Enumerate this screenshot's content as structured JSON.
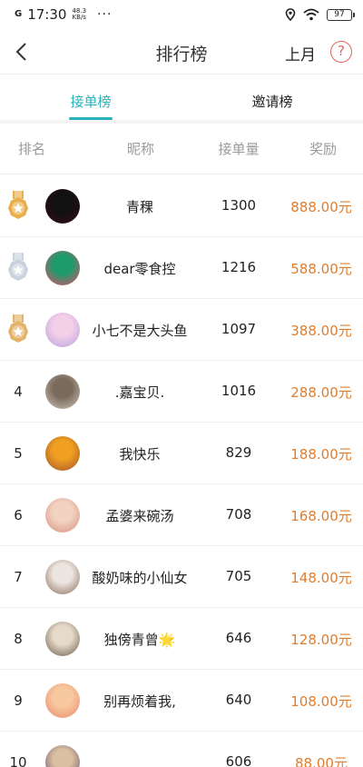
{
  "status_bar": {
    "signal": "G",
    "time": "17:30",
    "speed_value": "48.3",
    "speed_unit": "KB/s",
    "more": "···",
    "battery": "97"
  },
  "nav": {
    "title": "排行榜",
    "period": "上月",
    "help": "?"
  },
  "tabs": [
    {
      "label": "接单榜",
      "active": true
    },
    {
      "label": "邀请榜",
      "active": false
    }
  ],
  "columns": {
    "rank": "排名",
    "nickname": "昵称",
    "orders": "接单量",
    "reward": "奖励"
  },
  "colors": {
    "accent": "#27b3bc",
    "reward": "#e07d2c",
    "gold": "#e8b04b",
    "silver": "#c8d3df",
    "bronze": "#e3b36b"
  },
  "rows": [
    {
      "rank": "",
      "medal": "gold",
      "nickname": "青稞",
      "orders": "1300",
      "reward": "888.00元",
      "avatar_colors": [
        "#111111",
        "#3a0a1c"
      ]
    },
    {
      "rank": "",
      "medal": "silver",
      "nickname": "dear零食控",
      "orders": "1216",
      "reward": "588.00元",
      "avatar_colors": [
        "#1e9b6a",
        "#e84a6a"
      ]
    },
    {
      "rank": "",
      "medal": "bronze",
      "nickname": "小七不是大头鱼",
      "orders": "1097",
      "reward": "388.00元",
      "avatar_colors": [
        "#f4d0e8",
        "#b7a0e0"
      ]
    },
    {
      "rank": "4",
      "medal": "",
      "nickname": ".嘉宝贝.",
      "orders": "1016",
      "reward": "288.00元",
      "avatar_colors": [
        "#7a6a5c",
        "#cfc6bb"
      ]
    },
    {
      "rank": "5",
      "medal": "",
      "nickname": "我快乐",
      "orders": "829",
      "reward": "188.00元",
      "avatar_colors": [
        "#f0a020",
        "#a0522d"
      ]
    },
    {
      "rank": "6",
      "medal": "",
      "nickname": "孟婆来碗汤",
      "orders": "708",
      "reward": "168.00元",
      "avatar_colors": [
        "#f2d3c2",
        "#d89080"
      ]
    },
    {
      "rank": "7",
      "medal": "",
      "nickname": "酸奶味的小仙女",
      "orders": "705",
      "reward": "148.00元",
      "avatar_colors": [
        "#ede6e0",
        "#8a6a5a"
      ]
    },
    {
      "rank": "8",
      "medal": "",
      "nickname": "独傍青曾🌟",
      "orders": "646",
      "reward": "128.00元",
      "avatar_colors": [
        "#e6dac8",
        "#6a5a48"
      ]
    },
    {
      "rank": "9",
      "medal": "",
      "nickname": "别再烦着我,",
      "orders": "640",
      "reward": "108.00元",
      "avatar_colors": [
        "#f8c8a0",
        "#e88a68"
      ]
    },
    {
      "rank": "10",
      "medal": "",
      "nickname": "",
      "orders": "606",
      "reward": "88.00元",
      "avatar_colors": [
        "#d8c0a0",
        "#6a4a6a"
      ]
    }
  ]
}
